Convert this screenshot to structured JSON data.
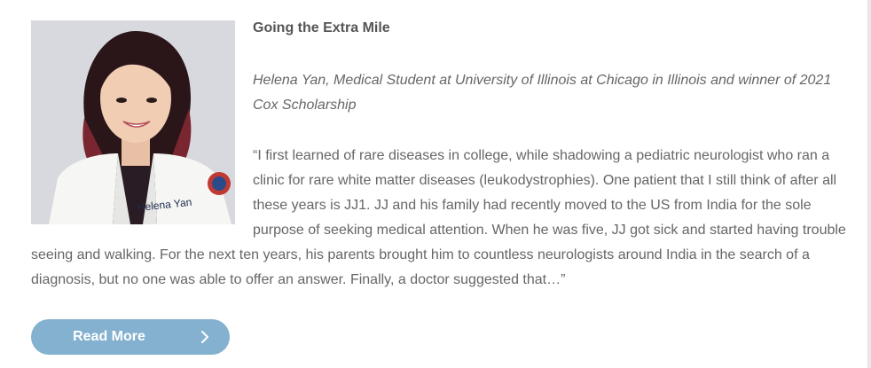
{
  "article": {
    "title": "Going the Extra Mile",
    "byline": "Helena Yan, Medical Student at University of Illinois at Chicago in Illinois and winner of 2021 Cox Scholarship",
    "quote": "“I first learned of rare diseases in college, while shadowing a pediatric neurologist who ran  a clinic for rare white matter diseases (leukodystrophies). One patient that I still think of after all  these years is JJ1. JJ and his family had recently moved to the US from India for the sole purpose  of seeking medical attention. When he was five, JJ got sick and started having trouble seeing and  walking. For the next ten years, his parents brought him to countless neurologists around India in  the search of a diagnosis, but no one was able to offer an answer. Finally, a doctor suggested that…”",
    "photo": {
      "coat_name": "Helena Yan"
    }
  },
  "actions": {
    "read_more_label": "Read More",
    "read_more_icon": "chevron-right-icon"
  },
  "colors": {
    "button": "#84b1cf",
    "text": "#666666",
    "title": "#555555"
  }
}
